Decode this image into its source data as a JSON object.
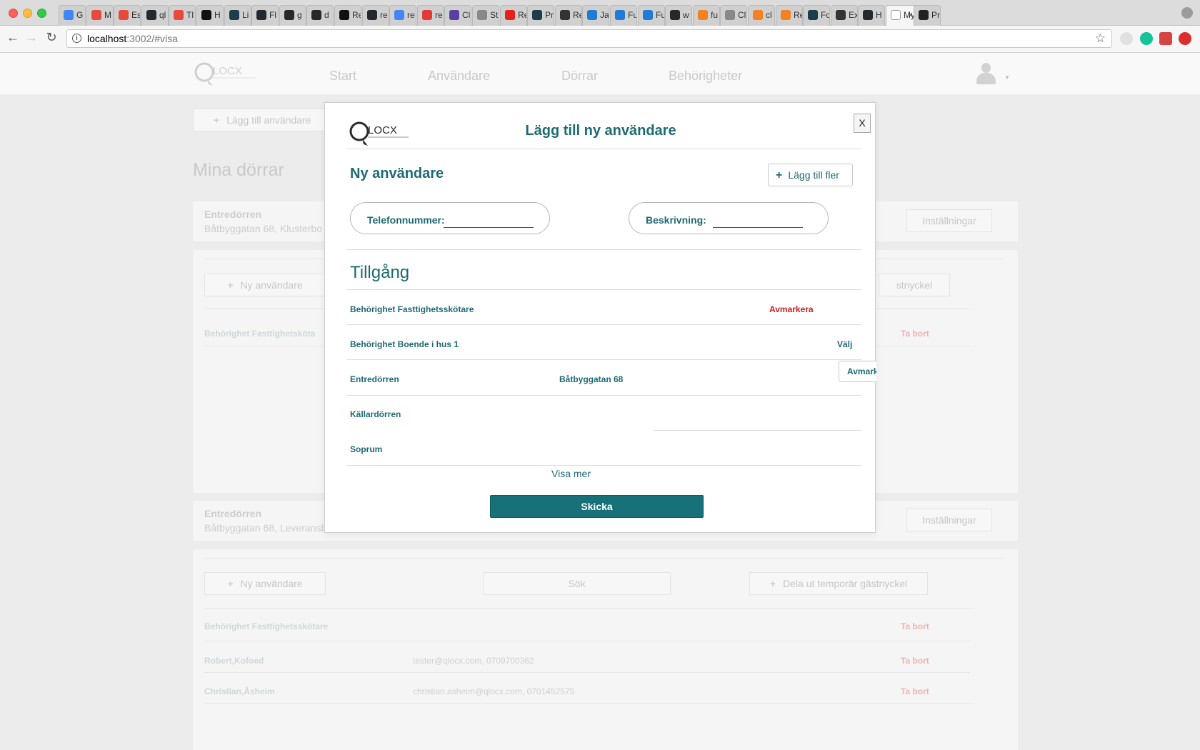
{
  "browser": {
    "tabs": [
      {
        "label": "G",
        "color": "#4285f4"
      },
      {
        "label": "M",
        "color": "#e64a3b"
      },
      {
        "label": "Es",
        "color": "#e64a3b"
      },
      {
        "label": "ql",
        "color": "#24292e"
      },
      {
        "label": "Tl",
        "color": "#e64a3b"
      },
      {
        "label": "H",
        "color": "#111111"
      },
      {
        "label": "Li",
        "color": "#1d3d4a"
      },
      {
        "label": "Fl",
        "color": "#24292e"
      },
      {
        "label": "g",
        "color": "#24292e"
      },
      {
        "label": "d",
        "color": "#24292e"
      },
      {
        "label": "Re",
        "color": "#111111"
      },
      {
        "label": "re",
        "color": "#24292e"
      },
      {
        "label": "re",
        "color": "#4285f4"
      },
      {
        "label": "re",
        "color": "#e53935"
      },
      {
        "label": "Cl",
        "color": "#5b3fa0"
      },
      {
        "label": "St",
        "color": "#888888"
      },
      {
        "label": "Re",
        "color": "#e62117"
      },
      {
        "label": "Pr",
        "color": "#1d3d4a"
      },
      {
        "label": "Re",
        "color": "#333333"
      },
      {
        "label": "Ja",
        "color": "#1f7bd6"
      },
      {
        "label": "Fu",
        "color": "#1f7bd6"
      },
      {
        "label": "Fu",
        "color": "#1f7bd6"
      },
      {
        "label": "w",
        "color": "#24292e"
      },
      {
        "label": "fu",
        "color": "#f48024"
      },
      {
        "label": "Cl",
        "color": "#888888"
      },
      {
        "label": "cl",
        "color": "#f48024"
      },
      {
        "label": "Re",
        "color": "#f48024"
      },
      {
        "label": "Fo",
        "color": "#1d3d4a"
      },
      {
        "label": "Ex",
        "color": "#333333"
      },
      {
        "label": "H",
        "color": "#24292e"
      },
      {
        "label": "My",
        "color": "#ffffff",
        "active": true
      },
      {
        "label": "Pr",
        "color": "#222222"
      }
    ],
    "close_glyph": "×",
    "url_host": "localhost",
    "url_path": ":3002/#visa",
    "back_glyph": "←",
    "forward_glyph": "→",
    "reload_glyph": "↻",
    "star_glyph": "☆",
    "info_glyph": "i"
  },
  "background": {
    "nav": [
      "Start",
      "Användare",
      "Dörrar",
      "Behörigheter"
    ],
    "add_user_label": "Lägg till användare",
    "page_title": "Mina dörrar",
    "door1": {
      "name": "Entredörren",
      "address": "Båtbyggatan 68, Klusterbo",
      "settings": "Inställningar"
    },
    "door1_actions": {
      "new_user": "Ny användare",
      "guest_key": "stnyckel"
    },
    "door1_row": {
      "label": "Behörighet Fasttighetsköta",
      "remove": "Ta bort"
    },
    "door2": {
      "name": "Entredörren",
      "address": "Båtbyggatan 68, Leveransb",
      "settings": "Inställningar"
    },
    "door2_actions": {
      "new_user": "Ny användare",
      "search": "Sök",
      "guest_key": "Dela ut temporär gästnyckel"
    },
    "door2_rows": [
      {
        "name": "Behörighet Fasttighetsskötare",
        "detail": "",
        "remove": "Ta bort"
      },
      {
        "name": "Robert,Kofoed",
        "detail": "tester@qlocx.com, 0709700362",
        "remove": "Ta bort"
      },
      {
        "name": "Christian,Åsheim",
        "detail": "christian.asheim@qlocx.com, 0701452575",
        "remove": "Ta bort"
      }
    ]
  },
  "modal": {
    "title": "Lägg till ny användare",
    "close_label": "X",
    "section_title": "Ny användare",
    "add_more_label": "Lägg till fler",
    "phone_label": "Telefonnummer:",
    "phone_value": "",
    "description_label": "Beskrivning:",
    "description_value": "",
    "access_title": "Tillgång",
    "rows": [
      {
        "label": "Behörighet Fasttighetsskötare",
        "action": "Avmarkera"
      },
      {
        "label": "Behörighet Boende i hus 1",
        "action": "Välj"
      },
      {
        "label": "Entredörren",
        "address": "Båtbyggatan 68",
        "action": "Avmark"
      },
      {
        "label": "Källardörren"
      },
      {
        "label": "Soprum"
      }
    ],
    "show_more": "Visa mer",
    "submit": "Skicka"
  },
  "colors": {
    "accent": "#1d6a73",
    "button": "#187178",
    "danger": "#d7191c"
  }
}
